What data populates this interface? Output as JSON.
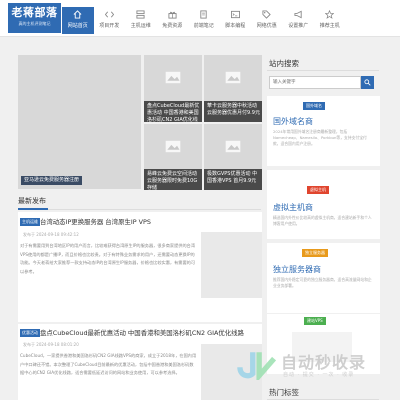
{
  "logo": {
    "main": "老蒋部落",
    "sub": "真的主机评测笔记"
  },
  "nav": [
    {
      "label": "网站首页",
      "icon": "home-icon",
      "active": true
    },
    {
      "label": "项目开发",
      "icon": "code-icon"
    },
    {
      "label": "主机运维",
      "icon": "server-icon"
    },
    {
      "label": "免费资源",
      "icon": "gift-icon"
    },
    {
      "label": "前端笔记",
      "icon": "note-icon"
    },
    {
      "label": "脚本编程",
      "icon": "terminal-icon"
    },
    {
      "label": "网络优惠",
      "icon": "tag-icon"
    },
    {
      "label": "设置推广",
      "icon": "megaphone-icon"
    },
    {
      "label": "推荐主机",
      "icon": "star-icon"
    }
  ],
  "featured": [
    {
      "title": "亚马逊云免费服务器注册"
    },
    {
      "title": "盘点CubeCloud最新优惠活动 中国香港和美国洛杉矶CN2 GIA优化线路"
    },
    {
      "title": "華卡云服务器中秋活动 云服务器优惠月付9.9元"
    },
    {
      "title": "易峰云免费云空间活动 云服务器限时免费10G存储"
    },
    {
      "title": "极数GVPS优惠活动 中国香港VPS 首月9.9元"
    }
  ],
  "latest": {
    "heading": "最新发布",
    "articles": [
      {
        "tag": "主机运维",
        "title": "台湾动态IP更换服务器 台湾原生IP VPS",
        "meta": "发布于 2024-09-18 09:42:12",
        "excerpt": "对于有需要用到台湾地区IP的用户而言，比较难获得台湾原生IP的服务器，很多商家提供的台湾VPS使用的都是广播IP，而且价格也比较贵。对于有特殊业务需求的用户，还需要动态更换IP的功能。今天老蒋给大家推荐一款支持动态IP的台湾原生IP服务器，价格也比较实惠，有需要的可以参考。"
      },
      {
        "tag": "优惠活动",
        "title": "盘点CubeCloud最新优惠活动 中国香港和美国洛杉矶CN2 GIA优化线路",
        "meta": "发布于 2024-09-18 08:01:20",
        "excerpt": "CubeCloud，一家提供香港和美国洛杉矶CN2 GIA线路VPS的商家，成立于2018年，在国内用户中口碑还不错。本次整理了CubeCloud目前最新的优惠活动，包括中国香港和美国洛杉矶数据中心的CN2 GIA优化线路，适合需要低延迟访问的网站和业务使用，可以参考选择。"
      }
    ]
  },
  "sidebar": {
    "search_title": "站内搜索",
    "search_placeholder": "输入关键字",
    "cards": [
      {
        "badge": "国外域名",
        "name": "国外域名商",
        "desc": "2024年常用国外域名注册商最新整理，包括Namecheap、Namesilo、Porkbun等，支持支付宝付款，适合国内用户注册。",
        "color": "#2f6bb3"
      },
      {
        "badge": "虚拟主机",
        "name": "虚拟主机商",
        "desc": "精选国内外性价比较高的虚拟主机商，适合建站新手和个人博客用户使用。",
        "color": "#e0452e"
      },
      {
        "badge": "独立服务器",
        "name": "独立服务器商",
        "desc": "推荐国内外稳定可靠的独立服务器商，适合高流量网站和企业业务部署。",
        "color": "#e89a1c"
      },
      {
        "badge": "建站VPS",
        "name": "",
        "desc": "",
        "color": "#4caf50"
      }
    ],
    "hot_title": "热门标签"
  },
  "watermark": {
    "text": "自动秒收录",
    "sub": "自动 · 提交 · 一次 · 收录"
  },
  "colors": {
    "accent": "#2f6bb3",
    "page_bg": "#f0f0f0"
  }
}
